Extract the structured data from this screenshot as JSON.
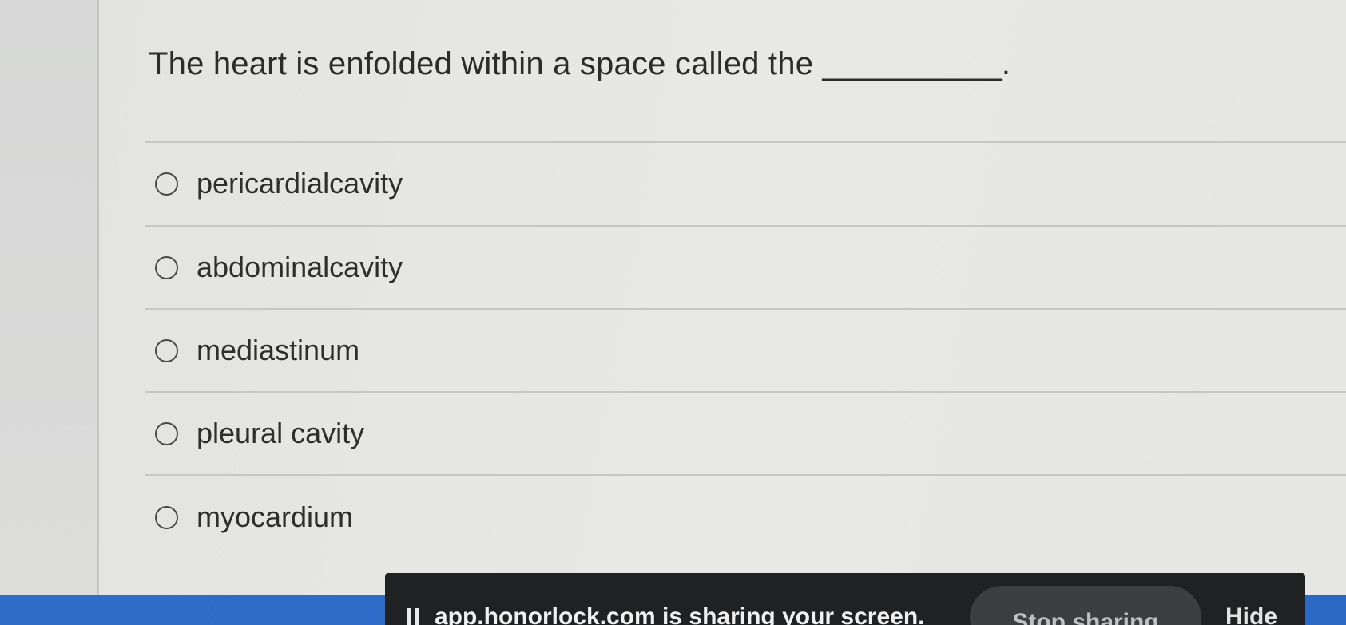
{
  "question": {
    "text": "The heart is enfolded within a space called the __________."
  },
  "options": [
    {
      "label": "pericardialcavity",
      "selected": false
    },
    {
      "label": "abdominalcavity",
      "selected": false
    },
    {
      "label": "mediastinum",
      "selected": false
    },
    {
      "label": "pleural cavity",
      "selected": false
    },
    {
      "label": "myocardium",
      "selected": false
    }
  ],
  "share_bar": {
    "message": "app.honorlock.com is sharing your screen.",
    "stop_label": "Stop sharing",
    "hide_label": "Hide"
  },
  "colors": {
    "background": "#e6e6e4",
    "text": "#2c2c2c",
    "taskbar": "#2e6ec9",
    "share_bar": "#1f2122"
  }
}
